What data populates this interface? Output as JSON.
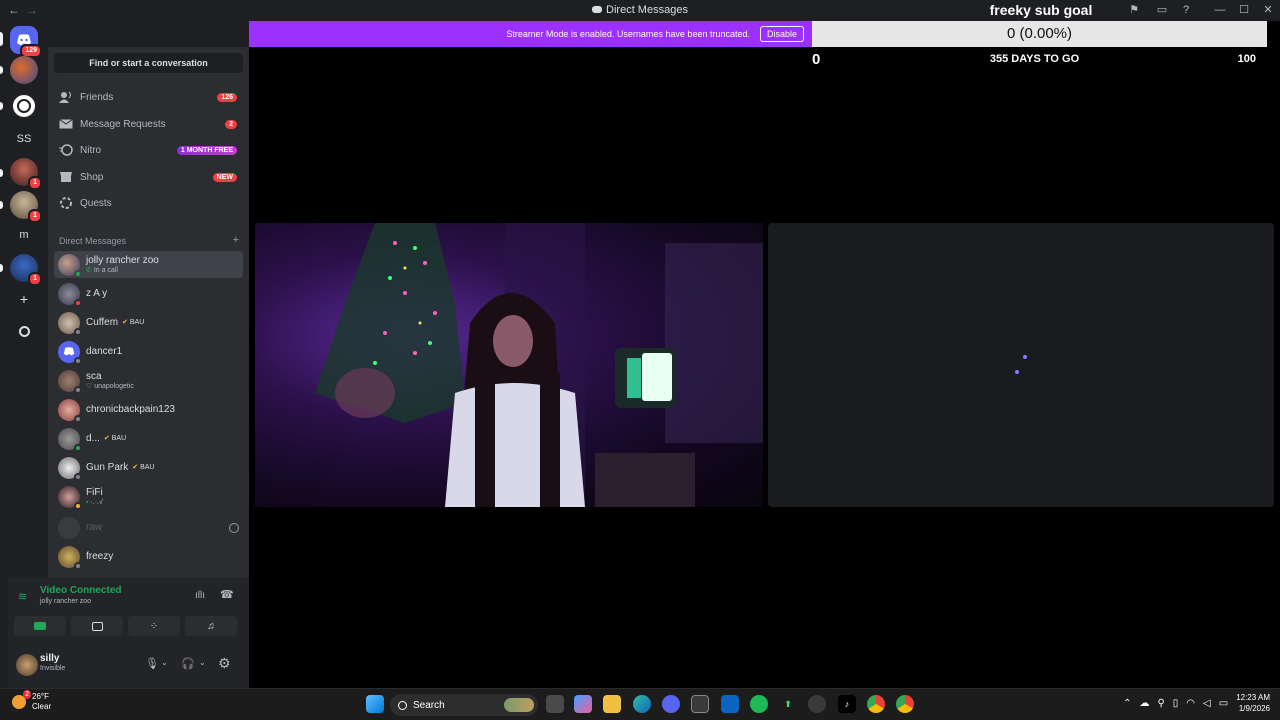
{
  "window": {
    "title": "Direct Messages",
    "back": "←",
    "forward": "→"
  },
  "servers": [
    {
      "id": "home",
      "badge": "129"
    },
    {
      "id": "s1",
      "badge": ""
    },
    {
      "id": "s2",
      "badge": ""
    },
    {
      "id": "s3",
      "label": "SS",
      "badge": ""
    },
    {
      "id": "s4",
      "badge": "1"
    },
    {
      "id": "s5",
      "badge": "1"
    },
    {
      "id": "s6",
      "label": "m",
      "badge": ""
    },
    {
      "id": "s7",
      "badge": "1"
    }
  ],
  "sidebar": {
    "find_placeholder": "Find or start a conversation",
    "nav": [
      {
        "label": "Friends",
        "badge": "126"
      },
      {
        "label": "Message Requests",
        "badge": "2"
      },
      {
        "label": "Nitro",
        "badge": "1 MONTH FREE"
      },
      {
        "label": "Shop",
        "badge": "NEW"
      },
      {
        "label": "Quests",
        "badge": ""
      }
    ],
    "dm_header": "Direct Messages",
    "dm_add": "+",
    "dms": [
      {
        "name": "jolly rancher zoo",
        "sub": "In a call"
      },
      {
        "name": "z A y",
        "sub": ""
      },
      {
        "name": "Cuffem",
        "tag": "BAU"
      },
      {
        "name": "dancer1",
        "sub": ""
      },
      {
        "name": "sca",
        "sub": "unapologetic"
      },
      {
        "name": "chronicbackpain123",
        "sub": ""
      },
      {
        "name": "d...",
        "tag": "BAU"
      },
      {
        "name": "Gun Park",
        "tag": "BAU"
      },
      {
        "name": "FiFi",
        "sub": "·.·.√"
      },
      {
        "name": "raw",
        "sub": ""
      },
      {
        "name": "freezy",
        "sub": ""
      }
    ]
  },
  "voice": {
    "status": "Video Connected",
    "channel": "jolly rancher zoo"
  },
  "user": {
    "name": "silly",
    "status": "Invisible"
  },
  "banner": {
    "text": "Streamer Mode is enabled. Usernames have been truncated.",
    "button": "Disable"
  },
  "goal": {
    "title": "freeky sub goal",
    "progress_text": "0 (0.00%)",
    "progress_fraction": 0,
    "min": "0",
    "max": "100",
    "days": "355 DAYS TO GO"
  },
  "taskbar": {
    "temp": "26°F",
    "weather": "Clear",
    "weather_badge": "2",
    "search": "Search",
    "time": "12:23 AM",
    "date": "1/9/2026"
  }
}
